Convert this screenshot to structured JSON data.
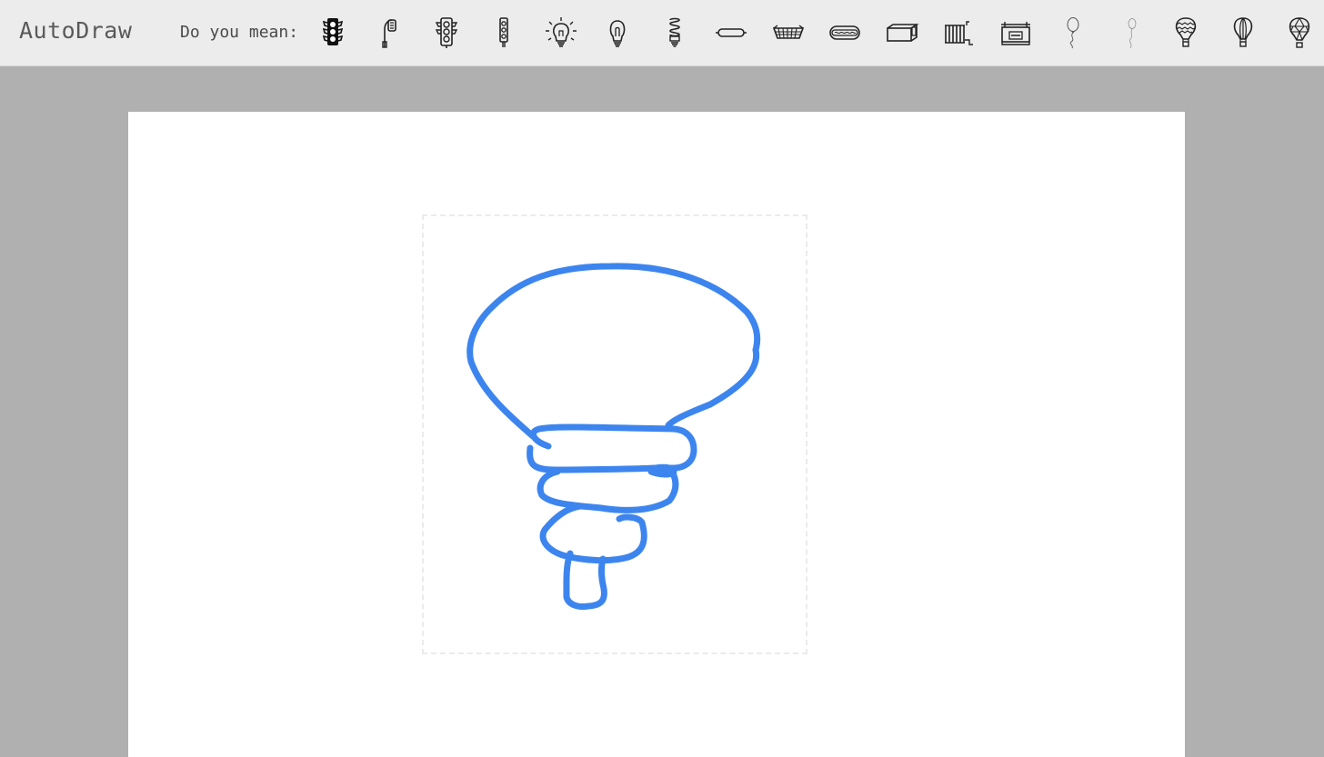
{
  "app": {
    "title": "AutoDraw"
  },
  "suggestions": {
    "label": "Do you mean:",
    "items": [
      {
        "icon": "traffic-light-filled-icon"
      },
      {
        "icon": "street-lamp-icon"
      },
      {
        "icon": "traffic-light-icon"
      },
      {
        "icon": "traffic-light-narrow-icon"
      },
      {
        "icon": "light-bulb-glowing-icon"
      },
      {
        "icon": "light-bulb-icon"
      },
      {
        "icon": "cfl-bulb-icon"
      },
      {
        "icon": "hot-dog-bun-icon"
      },
      {
        "icon": "basket-icon"
      },
      {
        "icon": "hot-dog-icon"
      },
      {
        "icon": "box-icon"
      },
      {
        "icon": "radiator-icon"
      },
      {
        "icon": "cash-register-icon"
      },
      {
        "icon": "balloon-icon"
      },
      {
        "icon": "balloon-thin-icon"
      },
      {
        "icon": "hot-air-balloon-icon"
      },
      {
        "icon": "hot-air-balloon-striped-icon"
      },
      {
        "icon": "hot-air-balloon-patterned-icon"
      }
    ]
  },
  "drawing": {
    "stroke_color": "#3d85ee",
    "subject": "user-sketch-light-bulb"
  },
  "colors": {
    "toolbar_bg": "#ececec",
    "workspace_bg": "#b0b0b0",
    "paper_bg": "#ffffff",
    "selection_border": "#ebebeb",
    "icon_stroke": "#222222"
  }
}
